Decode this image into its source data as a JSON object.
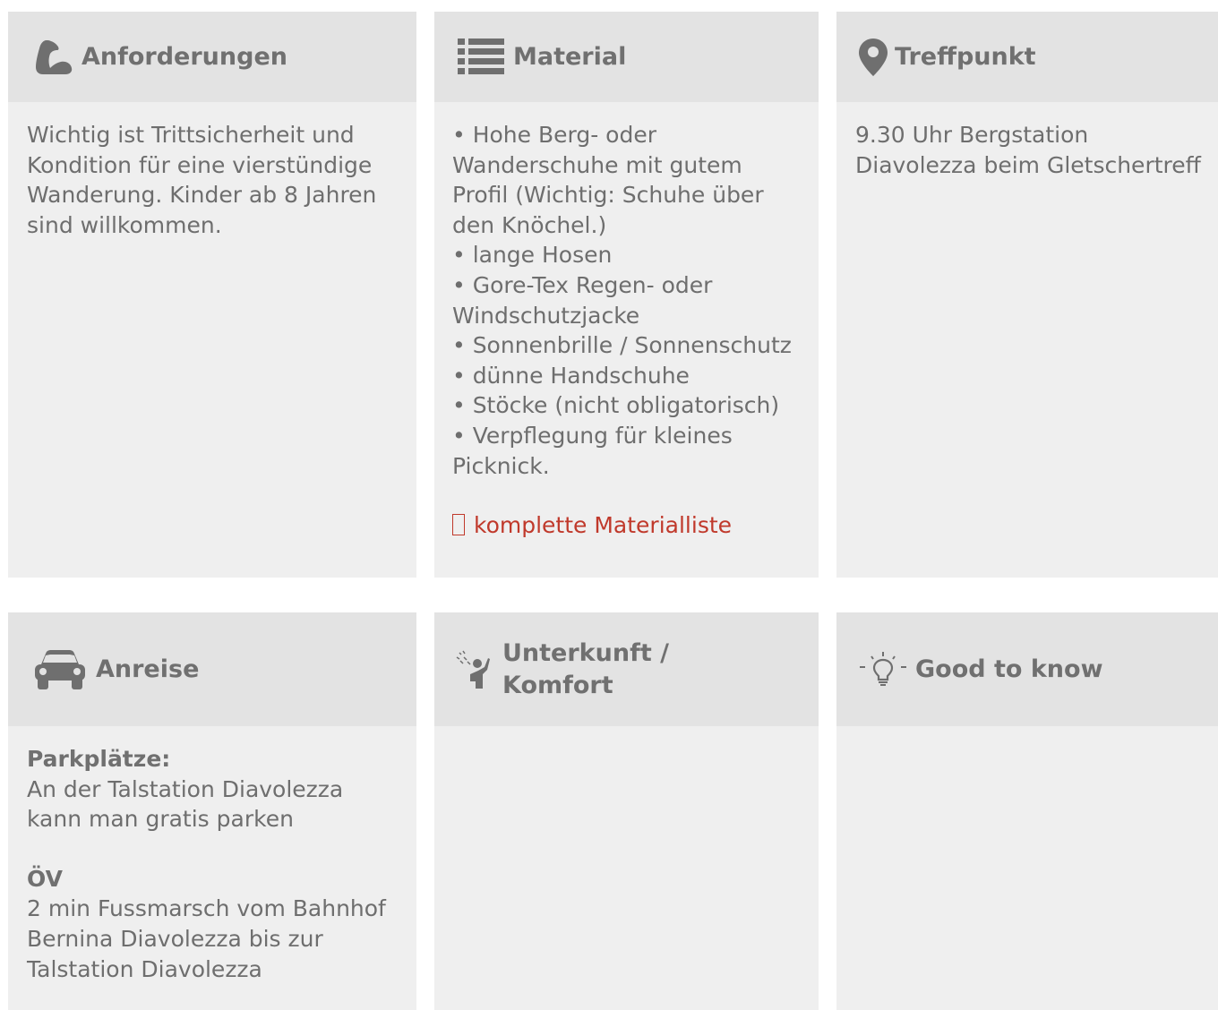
{
  "row1": {
    "anforderungen": {
      "title": "Anforderungen",
      "icon": "flexed-arm-icon",
      "text": "Wichtig ist Trittsicherheit und Kondition für eine vierstündige Wanderung. Kinder ab 8 Jahren sind willkommen."
    },
    "material": {
      "title": "Material",
      "icon": "list-icon",
      "lines": [
        "• Hohe Berg- oder Wanderschuhe mit gutem Profil (Wichtig: Schuhe über den Knöchel.)",
        "• lange Hosen",
        "• Gore-Tex Regen- oder Windschutzjacke",
        "• Sonnenbrille / Sonnenschutz",
        "• dünne Handschuhe",
        "• Stöcke (nicht obligatorisch)",
        "• Verpflegung für kleines Picknick."
      ],
      "link": "komplette Materialliste"
    },
    "treffpunkt": {
      "title": "Treffpunkt",
      "icon": "map-marker-icon",
      "text": "9.30 Uhr Bergstation Diavolezza beim Gletschertreff"
    }
  },
  "row2": {
    "anreise": {
      "title": "Anreise",
      "icon": "car-icon",
      "parking_label": "Parkplätze:",
      "parking_text": "An der Talstation Diavolezza kann man gratis parken",
      "ov_label": "ÖV",
      "ov_text": "2 min Fussmarsch vom Bahnhof Bernina Diavolezza bis zur Talstation Diavolezza"
    },
    "unterkunft": {
      "title": "Unterkunft / Komfort",
      "icon": "shower-icon"
    },
    "goodtoknow": {
      "title": "Good to know",
      "icon": "lightbulb-icon"
    }
  },
  "colors": {
    "card_bg": "#efefef",
    "header_bg": "#e3e3e3",
    "text": "#6e6e6e",
    "link": "#c0392b"
  }
}
